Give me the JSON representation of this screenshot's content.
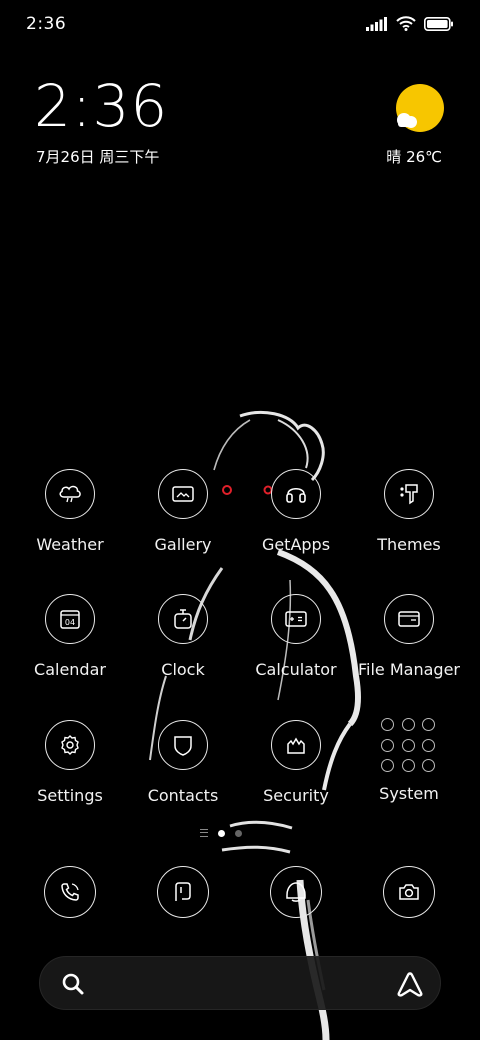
{
  "status_bar": {
    "time": "2:36",
    "icons": [
      "signal-icon",
      "wifi-icon",
      "battery-icon"
    ]
  },
  "clock_widget": {
    "time": "2:36",
    "date": "7月26日 周三下午"
  },
  "weather_widget": {
    "icon": "sun-cloud-icon",
    "text": "晴 26℃",
    "sun_color": "#f7c600"
  },
  "apps": [
    {
      "label": "Weather",
      "icon": "cloud-icon"
    },
    {
      "label": "Gallery",
      "icon": "image-icon"
    },
    {
      "label": "GetApps",
      "icon": "bag-icon"
    },
    {
      "label": "Themes",
      "icon": "brush-icon"
    },
    {
      "label": "Calendar",
      "icon": "calendar-icon",
      "day": "04"
    },
    {
      "label": "Clock",
      "icon": "timer-icon"
    },
    {
      "label": "Calculator",
      "icon": "calculator-icon"
    },
    {
      "label": "File Manager",
      "icon": "folder-icon"
    },
    {
      "label": "Settings",
      "icon": "gear-icon"
    },
    {
      "label": "Contacts",
      "icon": "contact-icon"
    },
    {
      "label": "Security",
      "icon": "shield-hand-icon"
    },
    {
      "label": "System",
      "icon": "folder-grid-icon"
    }
  ],
  "pager": {
    "pages": 2,
    "active": 1
  },
  "dock": [
    {
      "icon": "phone-icon"
    },
    {
      "icon": "message-icon"
    },
    {
      "icon": "browser-icon"
    },
    {
      "icon": "camera-icon"
    }
  ],
  "search": {
    "left_icon": "search-icon",
    "right_icon": "assistant-icon"
  }
}
